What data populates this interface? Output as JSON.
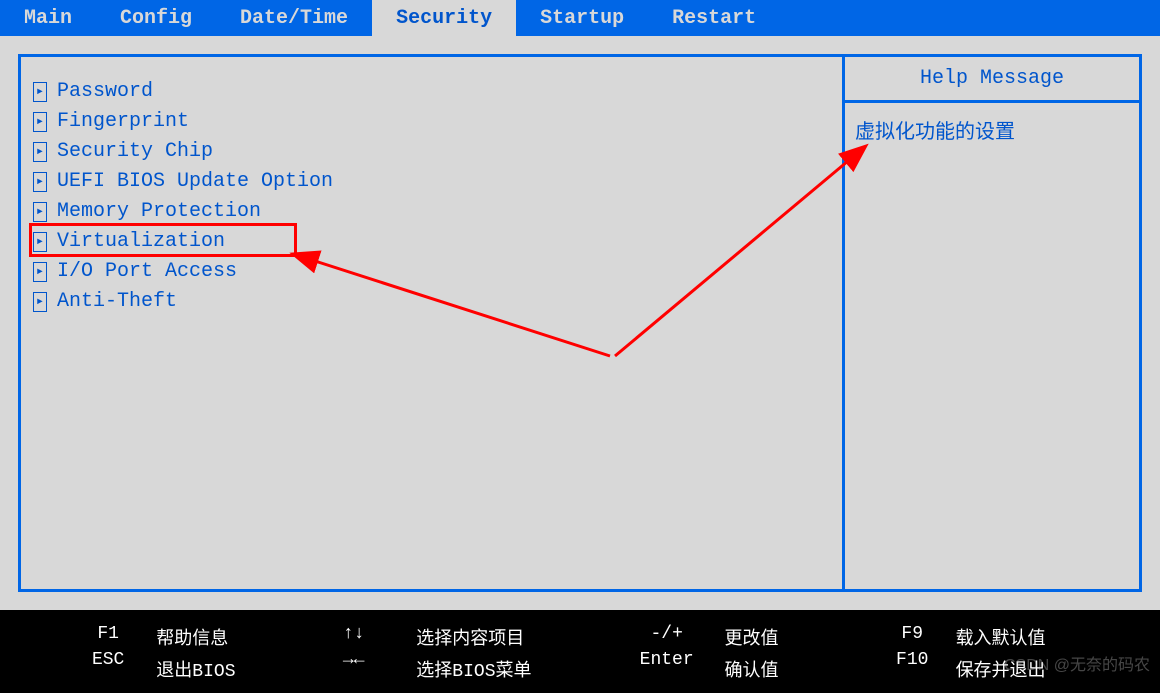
{
  "tabs": {
    "main": "Main",
    "config": "Config",
    "datetime": "Date/Time",
    "security": "Security",
    "startup": "Startup",
    "restart": "Restart"
  },
  "menu": {
    "password": "Password",
    "fingerprint": "Fingerprint",
    "security_chip": "Security Chip",
    "uefi_bios": "UEFI BIOS Update Option",
    "memory_protection": "Memory Protection",
    "virtualization": "Virtualization",
    "io_port": "I/O Port Access",
    "anti_theft": "Anti-Theft"
  },
  "help": {
    "title": "Help Message",
    "content": "虚拟化功能的设置"
  },
  "footer": {
    "f1_key": "F1",
    "f1_label": "帮助信息",
    "esc_key": "ESC",
    "esc_label": "退出BIOS",
    "updown_key": "↑↓",
    "updown_label": "选择内容项目",
    "leftright_key": "→←",
    "leftright_label": "选择BIOS菜单",
    "plusminus_key": "-/+",
    "plusminus_label": "更改值",
    "enter_key": "Enter",
    "enter_label": "确认值",
    "f9_key": "F9",
    "f9_label": "载入默认值",
    "f10_key": "F10",
    "f10_label": "保存并退出"
  },
  "watermark": "CSDN @无奈的码农"
}
